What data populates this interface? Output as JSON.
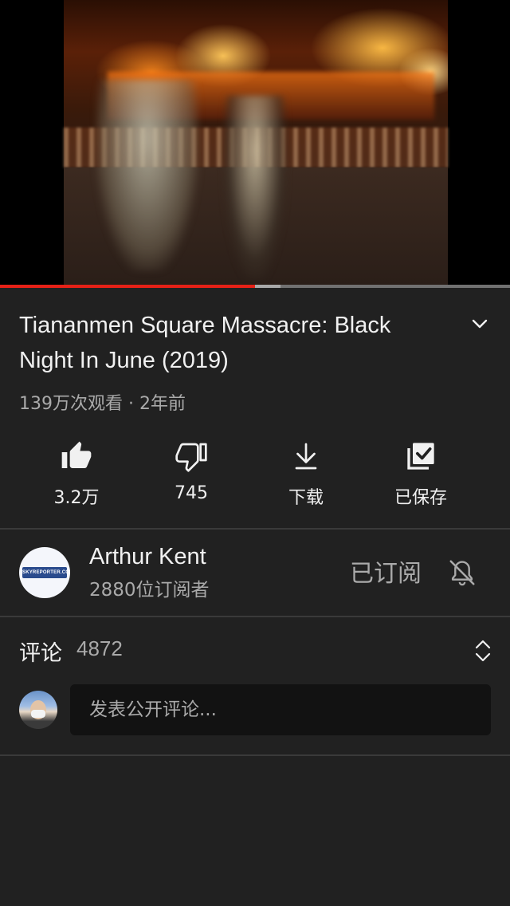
{
  "video": {
    "progress_played": 0.5,
    "progress_buffered": 0.55,
    "accent_color": "#e62117"
  },
  "title": "Tiananmen Square Massacre:  Black Night In June (2019)",
  "meta": "139万次观看 · 2年前",
  "actions": {
    "like_label": "3.2万",
    "dislike_label": "745",
    "download_label": "下载",
    "save_label": "已保存"
  },
  "channel": {
    "name": "Arthur Kent",
    "subscribers": "2880位订阅者",
    "avatar_text": "SKYREPORTER.COM",
    "subscribed_label": "已订阅"
  },
  "comments": {
    "label": "评论",
    "count": "4872",
    "placeholder": "发表公开评论..."
  },
  "icons": [
    "like-icon",
    "dislike-icon",
    "download-icon",
    "saved-icon",
    "chevron-down-icon",
    "bell-off-icon",
    "sort-icon"
  ]
}
